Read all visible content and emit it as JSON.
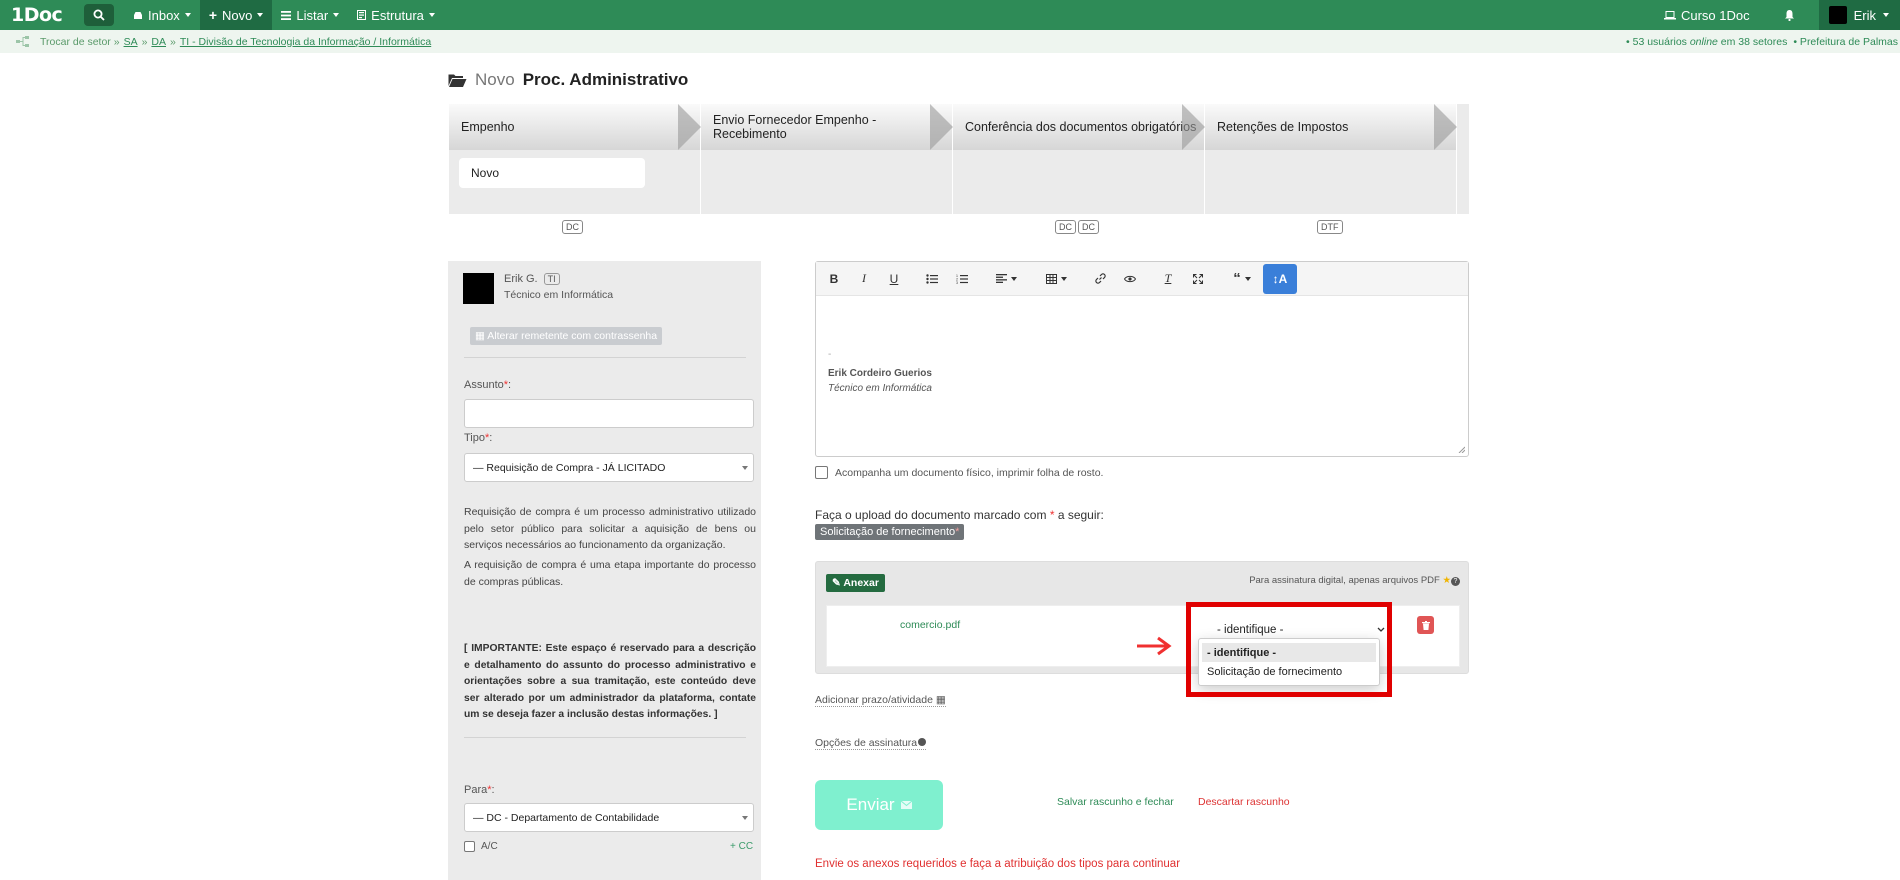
{
  "topbar": {
    "logo": "1Doc",
    "menu": [
      {
        "label": "Inbox",
        "icon": "inbox-icon"
      },
      {
        "label": "Novo",
        "icon": "plus-icon"
      },
      {
        "label": "Listar",
        "icon": "list-icon"
      },
      {
        "label": "Estrutura",
        "icon": "structure-icon"
      }
    ],
    "curso": "Curso 1Doc",
    "user": "Erik"
  },
  "subbar": {
    "trocar": "Trocar de setor »",
    "sa": "SA",
    "sep1": "»",
    "da": "DA",
    "sep2": "»",
    "setor": "TI - Divisão de Tecnologia da Informação / Informática",
    "users_prefix": "• 53 usuários",
    "online": "online",
    "users_suffix": "em 38 setores",
    "org": "• Prefeitura de Palmas"
  },
  "page": {
    "novo": "Novo",
    "title": "Proc. Administrativo"
  },
  "flow": {
    "steps": [
      {
        "label": "Empenho",
        "card": "Novo",
        "tags": [
          "DC"
        ]
      },
      {
        "label": "Envio Fornecedor Empenho - Recebimento",
        "card": "",
        "tags": []
      },
      {
        "label": "Conferência dos documentos obrigatórios",
        "card": "",
        "tags": [
          "DC",
          "DC"
        ]
      },
      {
        "label": "Retenções de Impostos",
        "card": "",
        "tags": [
          "DTF"
        ]
      }
    ]
  },
  "sender": {
    "name": "Erik G.",
    "sector": "TI",
    "role": "Técnico em Informática",
    "alt_button": "Alterar remetente com contrassenha"
  },
  "form": {
    "assunto_label": "Assunto",
    "assunto_value": "",
    "tipo_label": "Tipo",
    "tipo_value": "— Requisição de Compra - JÁ LICITADO",
    "desc1": "Requisição de compra é um processo administrativo utilizado pelo setor público para solicitar a aquisição de bens ou serviços necessários ao funcionamento da organização.",
    "desc2": "A requisição de compra é uma etapa importante do processo de compras públicas.",
    "important": "[ IMPORTANTE: Este espaço é reservado para a descrição e detalhamento do assunto do processo administrativo e orientações sobre a sua tramitação, este conteúdo deve ser alterado por um administrador da plataforma, contate um se deseja fazer a inclusão destas informações. ]",
    "para_label": "Para",
    "para_value": "— DC - Departamento de Contabilidade",
    "ac": "A/C",
    "cc": "+ CC"
  },
  "editor": {
    "dash": "-",
    "sig_name": "Erik Cordeiro Guerios",
    "sig_role": "Técnico em Informática"
  },
  "physical": "Acompanha um documento físico, imprimir folha de rosto.",
  "upload": {
    "text": "Faça o upload do documento marcado com",
    "asterisk": "*",
    "suffix": "a seguir:",
    "doc": "Solicitação de fornecimento"
  },
  "attach": {
    "button": "Anexar",
    "note": "Para assinatura digital, apenas arquivos PDF",
    "file": "comercio.pdf",
    "select_value": "- identifique -",
    "options": [
      "- identifique -",
      "Solicitação de fornecimento"
    ]
  },
  "links": {
    "prazo": "Adicionar prazo/atividade",
    "opcoes": "Opções de assinatura"
  },
  "actions": {
    "enviar": "Enviar",
    "salvar": "Salvar rascunho e fechar",
    "descartar": "Descartar rascunho",
    "error": "Envie os anexos requeridos e faça a atribuição dos tipos para continuar"
  }
}
